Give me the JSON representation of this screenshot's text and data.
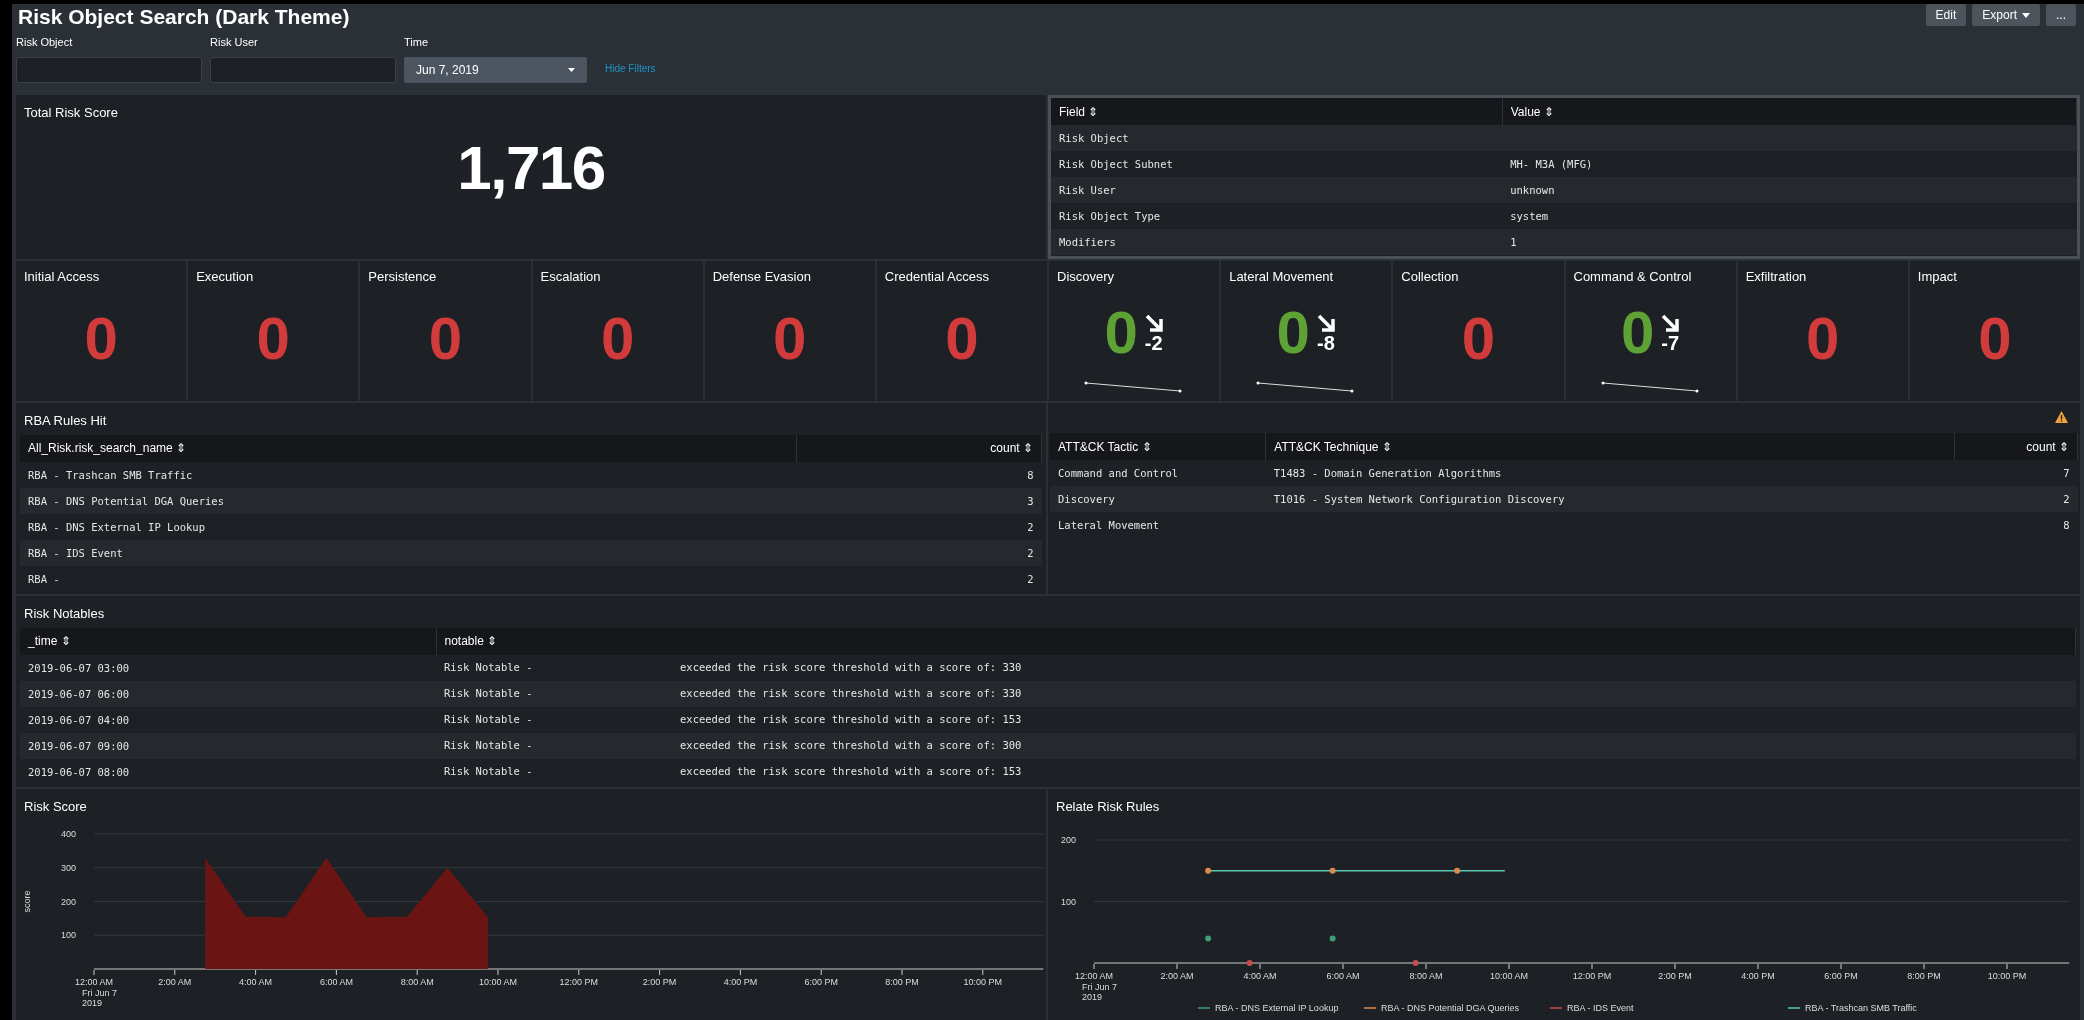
{
  "title": "Risk Object Search (Dark Theme)",
  "actions": [
    {
      "label": "Edit",
      "kind": "button"
    },
    {
      "label": "Export",
      "kind": "menu"
    },
    {
      "label": "...",
      "kind": "button"
    }
  ],
  "filters": [
    {
      "label": "Risk Object",
      "kind": "text"
    },
    {
      "label": "Risk User",
      "kind": "text"
    },
    {
      "label": "Time",
      "kind": "dropdown",
      "value": "Jun 7, 2019"
    }
  ],
  "hide_filters": "Hide Filters",
  "total_risk": {
    "title": "Total Risk Score",
    "value": "1,716"
  },
  "object_table": {
    "columns": [
      "Field ⇕",
      "Value ⇕"
    ],
    "rows": [
      [
        "Risk Object",
        ""
      ],
      [
        "Risk Object Subnet",
        "MH- M3A (MFG)"
      ],
      [
        "Risk User",
        "unknown"
      ],
      [
        "Risk Object Type",
        "system"
      ],
      [
        "Modifiers",
        "1"
      ]
    ]
  },
  "tactics": [
    {
      "label": "Initial Access",
      "value": "0",
      "color": "#d23b3b"
    },
    {
      "label": "Execution",
      "value": "0",
      "color": "#d23b3b"
    },
    {
      "label": "Persistence",
      "value": "0",
      "color": "#d23b3b"
    },
    {
      "label": "Escalation",
      "value": "0",
      "color": "#d23b3b"
    },
    {
      "label": "Defense Evasion",
      "value": "0",
      "color": "#d23b3b"
    },
    {
      "label": "Credential Access",
      "value": "0",
      "color": "#d23b3b"
    },
    {
      "label": "Discovery",
      "value": "0",
      "color": "#5ea135",
      "trend": "-2"
    },
    {
      "label": "Lateral Movement",
      "value": "0",
      "color": "#5ea135",
      "trend": "-8"
    },
    {
      "label": "Collection",
      "value": "0",
      "color": "#d23b3b"
    },
    {
      "label": "Command & Control",
      "value": "0",
      "color": "#5ea135",
      "trend": "-7"
    },
    {
      "label": "Exfiltration",
      "value": "0",
      "color": "#d23b3b"
    },
    {
      "label": "Impact",
      "value": "0",
      "color": "#d23b3b"
    }
  ],
  "rules_hit": {
    "title": "RBA Rules Hit",
    "columns": [
      "All_Risk.risk_search_name ⇕",
      "count ⇕"
    ],
    "rows": [
      [
        "RBA - Trashcan SMB Traffic",
        "8"
      ],
      [
        "RBA - DNS Potential DGA Queries",
        "3"
      ],
      [
        "RBA - DNS External IP Lookup",
        "2"
      ],
      [
        "RBA - IDS Event",
        "2"
      ],
      [
        "RBA -",
        "2"
      ]
    ]
  },
  "attack_table": {
    "warning": true,
    "columns": [
      "ATT&CK Tactic ⇕",
      "ATT&CK Technique ⇕",
      "count ⇕"
    ],
    "rows": [
      [
        "Command and Control",
        "T1483 - Domain Generation Algorithms",
        "7"
      ],
      [
        "Discovery",
        "T1016 - System Network Configuration Discovery",
        "2"
      ],
      [
        "Lateral Movement",
        "",
        "8"
      ]
    ]
  },
  "notables": {
    "title": "Risk Notables",
    "columns": [
      "_time ⇕",
      "notable ⇕"
    ],
    "rows": [
      {
        "time": "2019-06-07 03:00",
        "notable": "Risk Notable -",
        "detail": "exceeded the risk score threshold with a score of: 330"
      },
      {
        "time": "2019-06-07 06:00",
        "notable": "Risk Notable -",
        "detail": "exceeded the risk score threshold with a score of: 330"
      },
      {
        "time": "2019-06-07 04:00",
        "notable": "Risk Notable -",
        "detail": "exceeded the risk score threshold with a score of: 153"
      },
      {
        "time": "2019-06-07 09:00",
        "notable": "Risk Notable -",
        "detail": "exceeded the risk score threshold with a score of: 300"
      },
      {
        "time": "2019-06-07 08:00",
        "notable": "Risk Notable -",
        "detail": "exceeded the risk score threshold with a score of: 153"
      }
    ]
  },
  "risk_score": {
    "title": "Risk Score",
    "date_lines": [
      "Fri Jun 7",
      "2019"
    ],
    "chart_data": {
      "type": "area",
      "ylabel": "score",
      "x": [
        2.75,
        3.75,
        4.75,
        5.75,
        6.75,
        7.75,
        8.75,
        9.75
      ],
      "series": [
        {
          "color": "#6b1414",
          "values": [
            330,
            155,
            153,
            330,
            153,
            155,
            300,
            153
          ]
        }
      ],
      "grid": true,
      "xlim": [
        0,
        23.5
      ],
      "ylim": [
        0,
        400
      ],
      "yticks": [
        100,
        200,
        300,
        400
      ],
      "xticks": [
        {
          "value": 0,
          "label": "12:00 AM"
        },
        {
          "value": 2,
          "label": "2:00 AM"
        },
        {
          "value": 4,
          "label": "4:00 AM"
        },
        {
          "value": 6,
          "label": "6:00 AM"
        },
        {
          "value": 8,
          "label": "8:00 AM"
        },
        {
          "value": 10,
          "label": "10:00 AM"
        },
        {
          "value": 12,
          "label": "12:00 PM"
        },
        {
          "value": 14,
          "label": "2:00 PM"
        },
        {
          "value": 16,
          "label": "4:00 PM"
        },
        {
          "value": 18,
          "label": "6:00 PM"
        },
        {
          "value": 20,
          "label": "8:00 PM"
        },
        {
          "value": 22,
          "label": "10:00 PM"
        }
      ]
    }
  },
  "related_rules": {
    "title": "Relate Risk Rules",
    "date_lines": [
      "Fri Jun 7",
      "2019"
    ],
    "chart_data": {
      "type": "line",
      "x": [
        2.75,
        3.75,
        5.75,
        7.75,
        8.75,
        9.9
      ],
      "series": [
        {
          "name": "RBA - DNS External IP Lookup",
          "type": "scatter",
          "color": "#3f9e76",
          "values": [
            40,
            null,
            40,
            null,
            null,
            null
          ]
        },
        {
          "name": "RBA - DNS Potential DGA Queries",
          "type": "scatter",
          "color": "#d98b4f",
          "values": [
            150,
            null,
            150,
            null,
            150,
            null
          ]
        },
        {
          "name": "RBA - IDS Event",
          "type": "scatter",
          "color": "#c44e4e",
          "values": [
            null,
            0,
            null,
            0,
            null,
            null
          ]
        },
        {
          "name": "RBA - Trashcan SMB Traffic",
          "color": "#5ac9b0",
          "values": [
            150,
            150,
            150,
            150,
            150,
            150
          ]
        }
      ],
      "grid": true,
      "legend": "bottom",
      "xlim": [
        0,
        23.5
      ],
      "ylim": [
        0,
        200
      ],
      "yticks": [
        100,
        200
      ],
      "xticks": [
        {
          "value": 0,
          "label": "12:00 AM"
        },
        {
          "value": 2,
          "label": "2:00 AM"
        },
        {
          "value": 4,
          "label": "4:00 AM"
        },
        {
          "value": 6,
          "label": "6:00 AM"
        },
        {
          "value": 8,
          "label": "8:00 AM"
        },
        {
          "value": 10,
          "label": "10:00 AM"
        },
        {
          "value": 12,
          "label": "12:00 PM"
        },
        {
          "value": 14,
          "label": "2:00 PM"
        },
        {
          "value": 16,
          "label": "4:00 PM"
        },
        {
          "value": 18,
          "label": "6:00 PM"
        },
        {
          "value": 20,
          "label": "8:00 PM"
        },
        {
          "value": 22,
          "label": "10:00 PM"
        }
      ]
    }
  }
}
